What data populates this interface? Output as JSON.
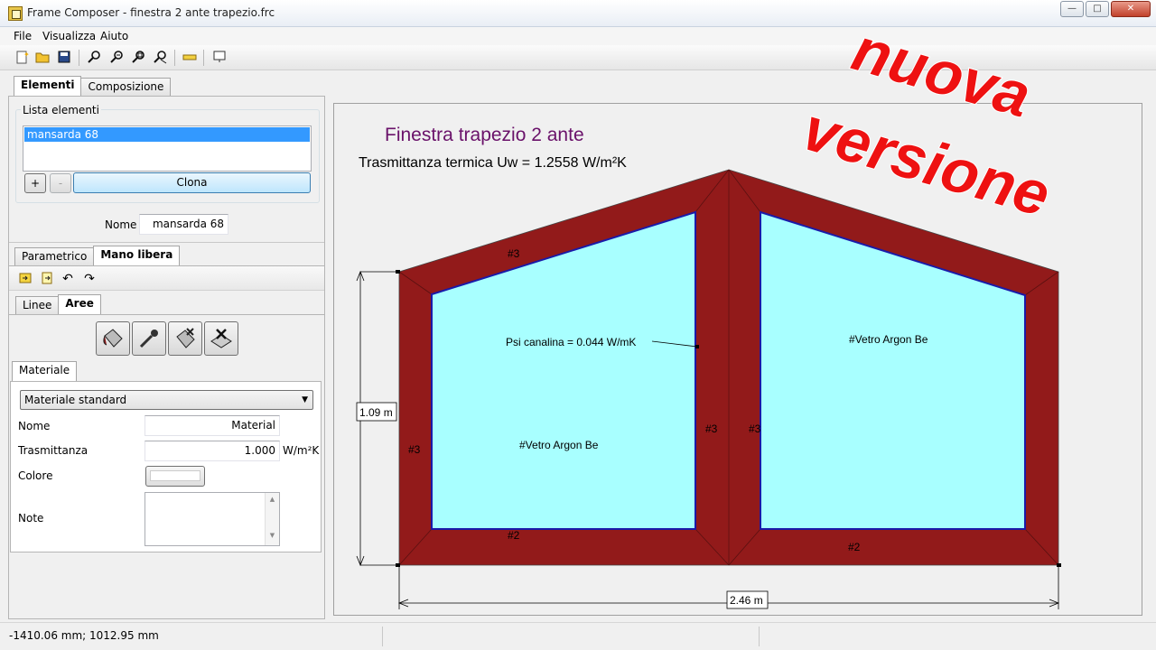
{
  "window": {
    "title": "Frame Composer - finestra 2 ante trapezio.frc"
  },
  "menu": [
    "File",
    "Visualizza",
    "Aiuto"
  ],
  "main_tabs": {
    "elements": "Elementi",
    "composition": "Composizione"
  },
  "element_list": {
    "group_label": "Lista elementi",
    "items": [
      "mansarda 68"
    ],
    "add_label": "+",
    "remove_label": "-",
    "clone_label": "Clona"
  },
  "name_field": {
    "label": "Nome",
    "value": "mansarda 68"
  },
  "edit_tabs": {
    "parametric": "Parametrico",
    "freehand": "Mano libera"
  },
  "sub_tabs": {
    "lines": "Linee",
    "areas": "Aree"
  },
  "material": {
    "tab_label": "Materiale",
    "selected": "Materiale standard",
    "name_label": "Nome",
    "name_value": "Material",
    "transmittance_label": "Trasmittanza",
    "transmittance_value": "1.000",
    "transmittance_unit": "W/m²K",
    "color_label": "Colore",
    "notes_label": "Note"
  },
  "drawing": {
    "title": "Finestra trapezio 2 ante",
    "subtitle": "Trasmittanza termica Uw = 1.2558 W/m²K",
    "psi_label": "Psi canalina = 0.044 W/mK",
    "glass_left": "#Vetro Argon Be",
    "glass_right": "#Vetro Argon Be",
    "profile_top": "#3",
    "profile_left": "#3",
    "profile_mid_left": "#3",
    "profile_mid_right": "#3",
    "profile_bottom_left": "#2",
    "profile_bottom_right": "#2",
    "height_dim": "1.09 m",
    "width_dim": "2.46 m",
    "frame_color": "#921a1a",
    "glass_color": "#a8ffff",
    "glass_edge_color": "#1a1aa8"
  },
  "overlay": {
    "line1": "nuova",
    "line2": "versione",
    "color": "#ee1111"
  },
  "status": {
    "coords": "-1410.06 mm; 1012.95 mm"
  }
}
